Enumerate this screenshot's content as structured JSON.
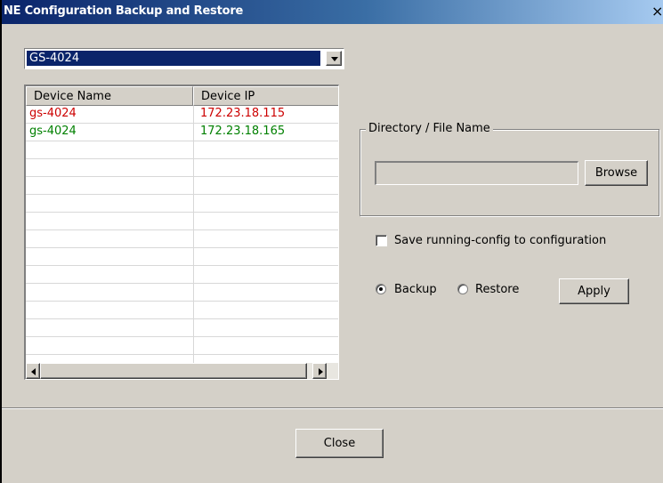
{
  "window": {
    "title": "NE Configuration Backup and Restore",
    "close_glyph": "×"
  },
  "device_select": {
    "selected": "GS-4024"
  },
  "device_table": {
    "headers": [
      "Device Name",
      "Device IP"
    ],
    "rows": [
      {
        "name": "gs-4024",
        "ip": "172.23.18.115",
        "color": "#cc0000"
      },
      {
        "name": "gs-4024",
        "ip": "172.23.18.165",
        "color": "#008000"
      }
    ],
    "empty_rows": 12
  },
  "directory_group": {
    "legend": "Directory / File Name",
    "path_value": "",
    "browse_label": "Browse"
  },
  "options": {
    "save_label": "Save running-config to configuration",
    "save_checked": false,
    "backup_label": "Backup",
    "restore_label": "Restore",
    "mode": "Backup",
    "apply_label": "Apply"
  },
  "footer": {
    "close_label": "Close"
  },
  "icons": {
    "dropdown": "chevron-down-icon",
    "scroll_left": "arrow-left-icon",
    "scroll_right": "arrow-right-icon"
  }
}
